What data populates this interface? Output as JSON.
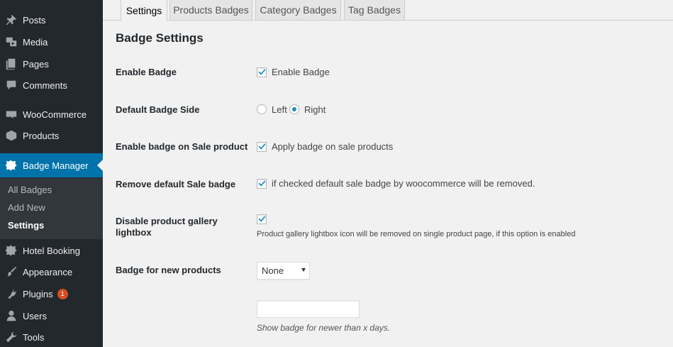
{
  "sidebar": {
    "items": [
      {
        "label": "Posts",
        "icon": "pin-icon"
      },
      {
        "label": "Media",
        "icon": "media-icon"
      },
      {
        "label": "Pages",
        "icon": "pages-icon"
      },
      {
        "label": "Comments",
        "icon": "comment-icon"
      },
      {
        "label": "WooCommerce",
        "icon": "woocommerce-icon"
      },
      {
        "label": "Products",
        "icon": "box-icon"
      },
      {
        "label": "Badge Manager",
        "icon": "gear-icon"
      },
      {
        "label": "Hotel Booking",
        "icon": "gear-icon"
      },
      {
        "label": "Appearance",
        "icon": "brush-icon"
      },
      {
        "label": "Plugins",
        "icon": "plug-icon",
        "count": "1"
      },
      {
        "label": "Users",
        "icon": "user-icon"
      },
      {
        "label": "Tools",
        "icon": "wrench-icon"
      }
    ],
    "submenu": [
      "All Badges",
      "Add New",
      "Settings"
    ]
  },
  "tabs": [
    "Settings",
    "Products Badges",
    "Category Badges",
    "Tag Badges"
  ],
  "page_title": "Badge Settings",
  "fields": {
    "enable_badge": {
      "label": "Enable Badge",
      "option": "Enable Badge",
      "checked": true
    },
    "default_side": {
      "label": "Default Badge Side",
      "left": "Left",
      "right": "Right",
      "selected": "Right"
    },
    "sale_product": {
      "label": "Enable badge on Sale product",
      "option": "Apply badge on sale products",
      "checked": true
    },
    "remove_default": {
      "label": "Remove default Sale badge",
      "option": "if checked default sale badge by woocommerce will be removed.",
      "checked": true
    },
    "disable_lightbox": {
      "label_line1": "Disable product gallery",
      "label_line2": "lightbox",
      "description": "Product gallery lightbox icon will be removed on single product page, if this option is enabled",
      "checked": true
    },
    "new_products": {
      "label": "Badge for new products",
      "select_value": "None",
      "days_value": "",
      "days_description": "Show badge for newer than x days."
    }
  },
  "colors": {
    "sidebar_bg": "#23282d",
    "accent": "#0073aa",
    "checkmark": "#1e8cbe",
    "notification": "#d54e21"
  }
}
